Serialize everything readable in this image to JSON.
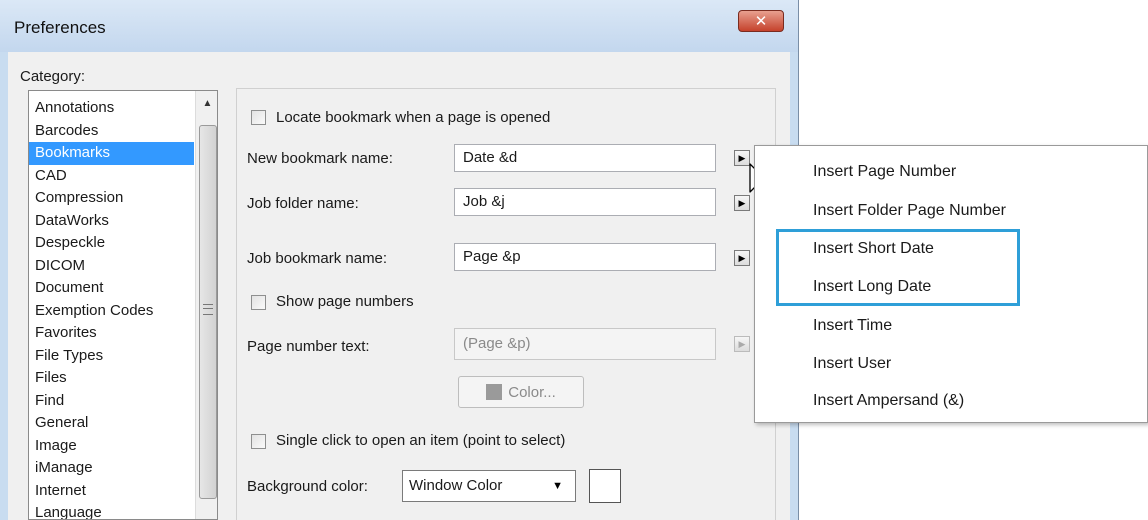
{
  "window": {
    "title": "Preferences",
    "close_label": "✕"
  },
  "category": {
    "label": "Category:",
    "items": [
      {
        "label": "Annotations",
        "selected": false
      },
      {
        "label": "Barcodes",
        "selected": false
      },
      {
        "label": "Bookmarks",
        "selected": true
      },
      {
        "label": "CAD",
        "selected": false
      },
      {
        "label": "Compression",
        "selected": false
      },
      {
        "label": "DataWorks",
        "selected": false
      },
      {
        "label": "Despeckle",
        "selected": false
      },
      {
        "label": "DICOM",
        "selected": false
      },
      {
        "label": "Document",
        "selected": false
      },
      {
        "label": "Exemption Codes",
        "selected": false
      },
      {
        "label": "Favorites",
        "selected": false
      },
      {
        "label": "File Types",
        "selected": false
      },
      {
        "label": "Files",
        "selected": false
      },
      {
        "label": "Find",
        "selected": false
      },
      {
        "label": "General",
        "selected": false
      },
      {
        "label": "Image",
        "selected": false
      },
      {
        "label": "iManage",
        "selected": false
      },
      {
        "label": "Internet",
        "selected": false
      },
      {
        "label": "Language",
        "selected": false
      }
    ]
  },
  "bookmarks": {
    "locate_bookmark_label": "Locate bookmark when a page is opened",
    "locate_bookmark_checked": false,
    "new_bookmark_name_label": "New bookmark name:",
    "new_bookmark_name_value": "Date &d",
    "job_folder_name_label": "Job folder name:",
    "job_folder_name_value": "Job &j",
    "job_bookmark_name_label": "Job bookmark name:",
    "job_bookmark_name_value": "Page &p",
    "show_page_numbers_label": "Show page numbers",
    "show_page_numbers_checked": false,
    "page_number_text_label": "Page number text:",
    "page_number_text_value": "(Page &p)",
    "color_button_label": "Color...",
    "single_click_label": "Single click to open an item (point to select)",
    "single_click_checked": false,
    "background_color_label": "Background color:",
    "background_color_value": "Window Color",
    "background_swatch_color": "#ffffff"
  },
  "insert_menu": {
    "items": [
      "Insert Page Number",
      "Insert Folder Page Number",
      "Insert Short Date",
      "Insert Long Date",
      "Insert Time",
      "Insert User",
      "Insert Ampersand (&)"
    ],
    "highlight_color": "#2e9fd8"
  },
  "colors": {
    "selection": "#3399ff",
    "close_button": "#c5422c",
    "titlebar": "#c3d7ee"
  }
}
